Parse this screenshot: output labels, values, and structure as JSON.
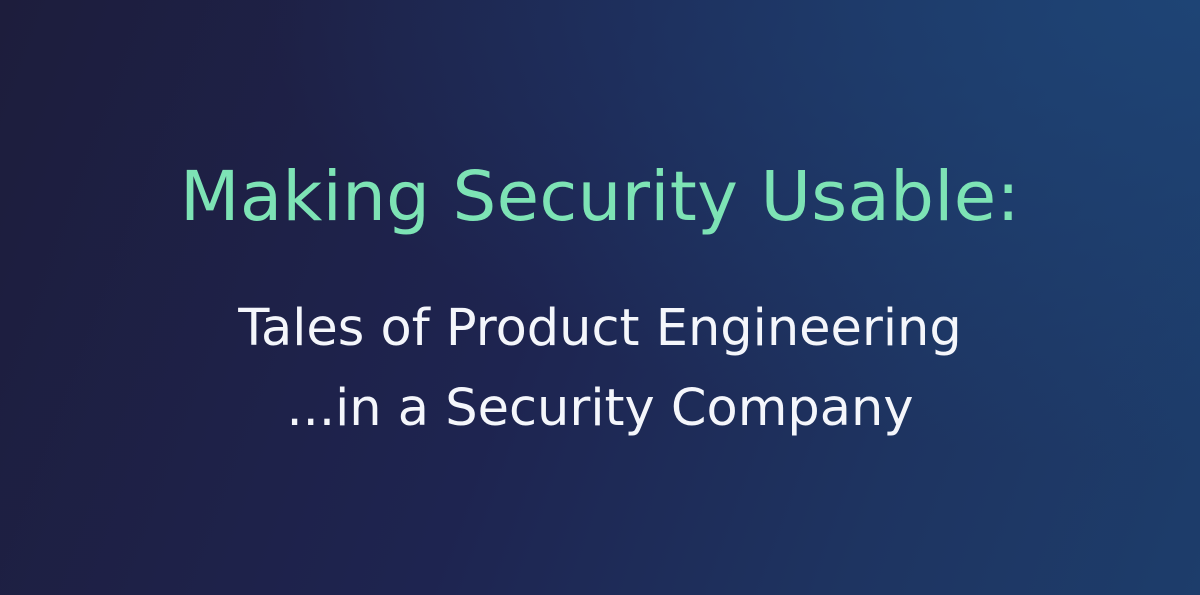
{
  "slide": {
    "title": "Making Security Usable:",
    "subtitle_line_1": "Tales of Product Engineering",
    "subtitle_line_2": "...in a Security Company",
    "colors": {
      "background": "#1e2450",
      "title": "#7de3b5",
      "subtitle": "#f4f6fb"
    }
  }
}
